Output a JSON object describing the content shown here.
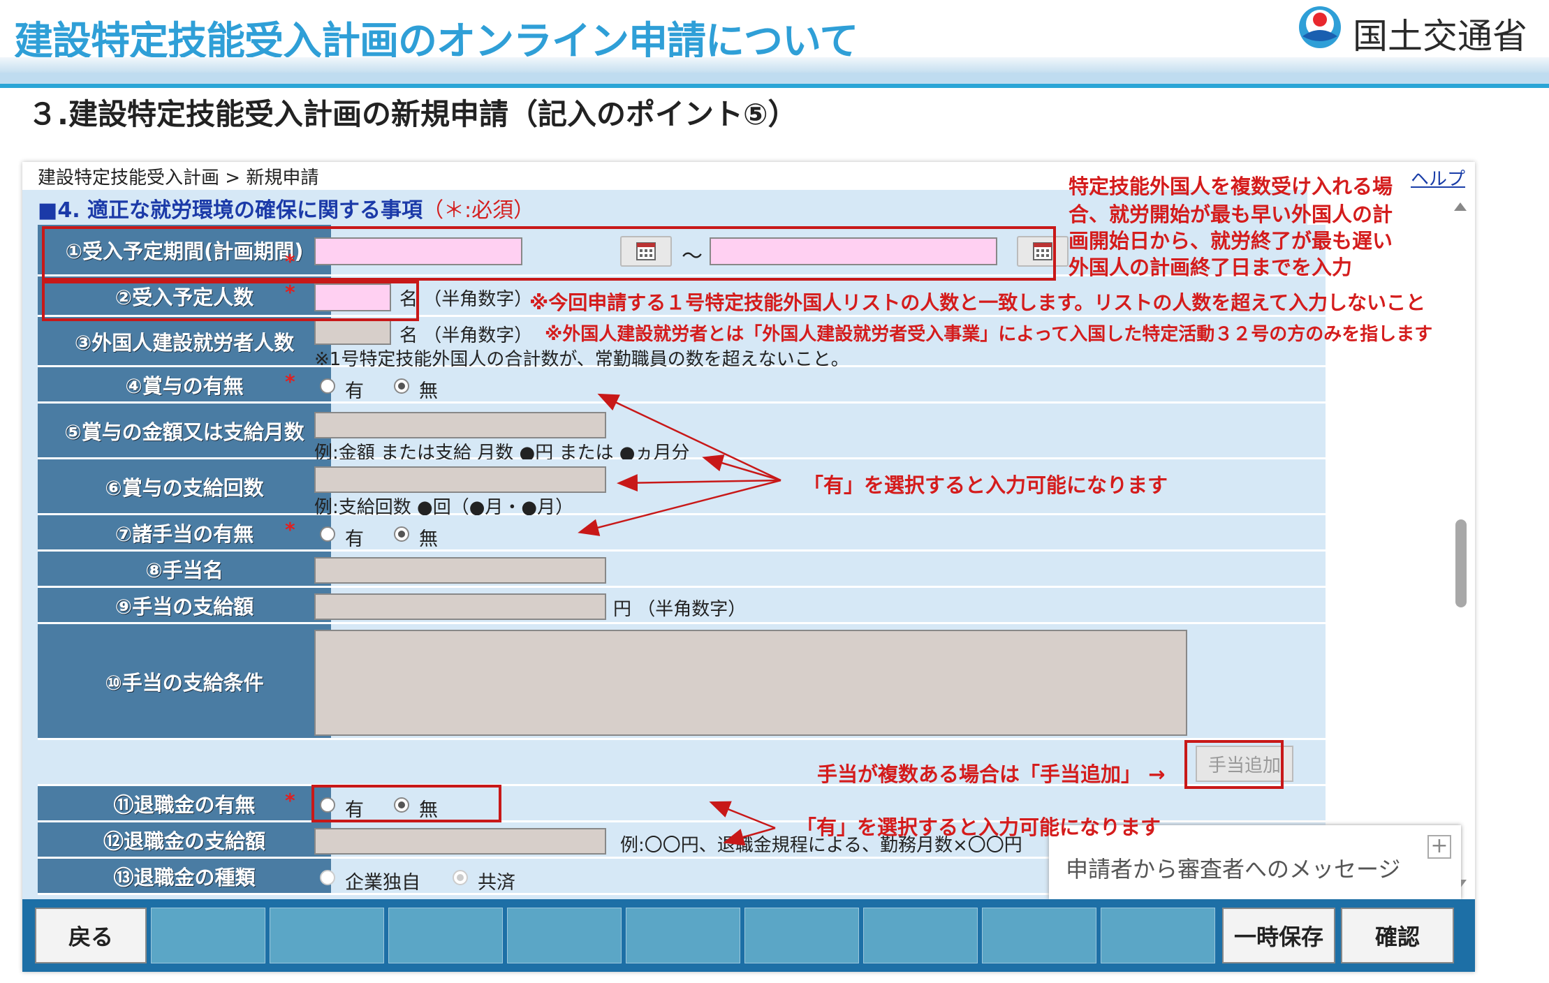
{
  "slide": {
    "title": "建設特定技能受入計画のオンライン申請について",
    "org": "国土交通省",
    "section": "３.建設特定技能受入計画の新規申請（記入のポイント⑤）"
  },
  "app": {
    "breadcrumb": "建設特定技能受入計画 > 新規申請",
    "help_link": "ヘルプ",
    "section_heading": "■4. 適正な就労環境の確保に関する事項",
    "required_note": "（＊:必須）",
    "fields": {
      "f1": {
        "label": "①受入予定期間(計画期間)",
        "range_sep": "～"
      },
      "f2": {
        "label": "②受入予定人数",
        "unit": "名 （半角数字）"
      },
      "f3": {
        "label": "③外国人建設就労者人数",
        "unit": "名 （半角数字）",
        "note": "※1号特定技能外国人の合計数が、常勤職員の数を超えないこと。"
      },
      "f4": {
        "label": "④賞与の有無",
        "opt_yes": "有",
        "opt_no": "無",
        "selected": "無"
      },
      "f5": {
        "label": "⑤賞与の金額又は支給月数",
        "example": "例:金額 または支給 月数 ●円 または ●ヵ月分"
      },
      "f6": {
        "label": "⑥賞与の支給回数",
        "example": "例:支給回数 ●回（●月・●月）"
      },
      "f7": {
        "label": "⑦諸手当の有無",
        "opt_yes": "有",
        "opt_no": "無",
        "selected": "無"
      },
      "f8": {
        "label": "⑧手当名"
      },
      "f9": {
        "label": "⑨手当の支給額",
        "unit": "円 （半角数字）"
      },
      "f10": {
        "label": "⑩手当の支給条件"
      },
      "add_allowance_button": "手当追加",
      "f11": {
        "label": "⑪退職金の有無",
        "opt_yes": "有",
        "opt_no": "無",
        "selected": "無"
      },
      "f12": {
        "label": "⑫退職金の支給額",
        "example": "例:〇〇円、退職金規程による、勤務月数×〇〇円"
      },
      "f13": {
        "label": "⑬退職金の種類",
        "opt_a": "企業独自",
        "opt_b": "共済",
        "selected": "共済"
      }
    },
    "message_panel": "申請者から審査者へのメッセージ",
    "buttons": {
      "back": "戻る",
      "save_draft": "一時保存",
      "confirm": "確認"
    }
  },
  "annotations": {
    "period_line1": "特定技能外国人を複数受け入れる場",
    "period_line2": "合、就労開始が最も早い外国人の計",
    "period_line3": "画開始日から、就労終了が最も遅い",
    "period_line4": "外国人の計画終了日までを入力",
    "headcount": "※今回申請する１号特定技能外国人リストの人数と一致します。リストの人数を超えて入力しないこと",
    "foreign_workers": "※外国人建設就労者とは「外国人建設就労者受入事業」によって入国した特定活動３２号の方のみを指します",
    "enable_hint": "「有」を選択すると入力可能になります",
    "add_allowance_hint": "手当が複数ある場合は「手当追加」 →",
    "enable_hint2": "「有」を選択すると入力可能になります"
  }
}
